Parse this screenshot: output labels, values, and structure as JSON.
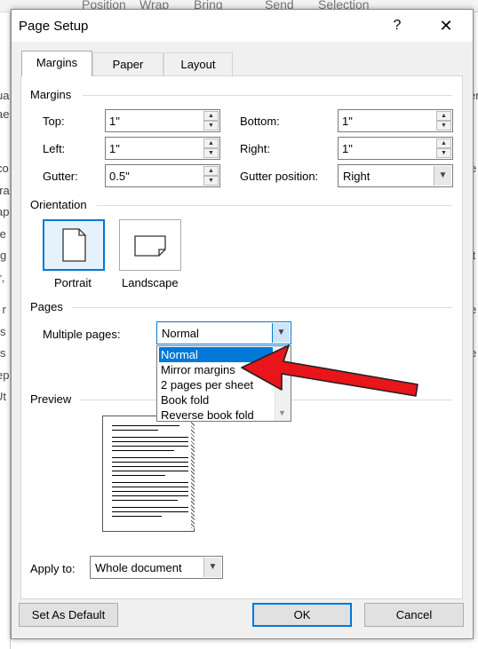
{
  "background": {
    "ribbon_items": [
      "Position",
      "Wrap",
      "Bring",
      "Send",
      "Selection"
    ],
    "left_fragments": [
      "ua",
      "ae",
      "co",
      "ora",
      "ap",
      "te",
      "g",
      "r,",
      "l r",
      "s",
      "s",
      "ep",
      "Ut"
    ],
    "right_fragments": [
      "er",
      "I",
      "e",
      "tt",
      "e",
      "e",
      "I"
    ]
  },
  "dialog": {
    "title": "Page Setup",
    "help_glyph": "?",
    "close_glyph": "✕"
  },
  "tabs": [
    {
      "label": "Margins",
      "active": true
    },
    {
      "label": "Paper",
      "active": false
    },
    {
      "label": "Layout",
      "active": false
    }
  ],
  "margins": {
    "group_label": "Margins",
    "top": {
      "label": "Top:",
      "value": "1\""
    },
    "left": {
      "label": "Left:",
      "value": "1\""
    },
    "gutter": {
      "label": "Gutter:",
      "value": "0.5\""
    },
    "bottom": {
      "label": "Bottom:",
      "value": "1\""
    },
    "right": {
      "label": "Right:",
      "value": "1\""
    },
    "gutter_position": {
      "label": "Gutter position:",
      "value": "Right"
    }
  },
  "orientation": {
    "group_label": "Orientation",
    "portrait": "Portrait",
    "landscape": "Landscape",
    "selected": "Portrait"
  },
  "pages": {
    "group_label": "Pages",
    "multiple_pages_label": "Multiple pages:",
    "multiple_pages_value": "Normal",
    "options": [
      "Normal",
      "Mirror margins",
      "2 pages per sheet",
      "Book fold",
      "Reverse book fold"
    ],
    "highlighted": "Normal"
  },
  "preview": {
    "group_label": "Preview"
  },
  "apply_to": {
    "label": "Apply to:",
    "value": "Whole document"
  },
  "buttons": {
    "set_default": "Set As Default",
    "ok": "OK",
    "cancel": "Cancel"
  },
  "colors": {
    "accent": "#0078d7",
    "annotation_arrow": "#e8151b"
  }
}
